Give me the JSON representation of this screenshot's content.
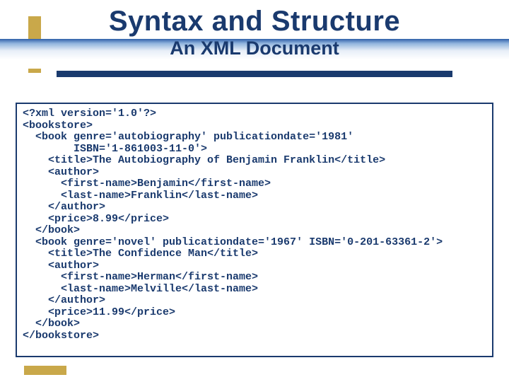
{
  "header": {
    "title": "Syntax and Structure",
    "subtitle": "An XML Document"
  },
  "code": {
    "lines": [
      "<?xml version='1.0'?>",
      "<bookstore>",
      "  <book genre='autobiography' publicationdate='1981'",
      "        ISBN='1-861003-11-0'>",
      "    <title>The Autobiography of Benjamin Franklin</title>",
      "    <author>",
      "      <first-name>Benjamin</first-name>",
      "      <last-name>Franklin</last-name>",
      "    </author>",
      "    <price>8.99</price>",
      "  </book>",
      "  <book genre='novel' publicationdate='1967' ISBN='0-201-63361-2'>",
      "    <title>The Confidence Man</title>",
      "    <author>",
      "      <first-name>Herman</first-name>",
      "      <last-name>Melville</last-name>",
      "    </author>",
      "    <price>11.99</price>",
      "  </book>",
      "</bookstore>"
    ]
  }
}
